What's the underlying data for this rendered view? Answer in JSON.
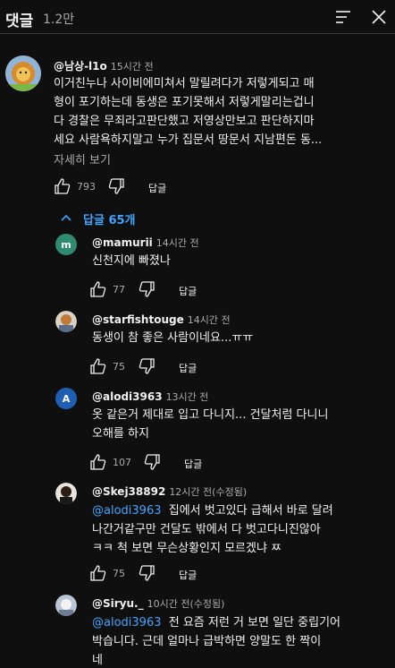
{
  "header": {
    "title": "댓글",
    "count": "1.2만",
    "sort_icon": "sort-icon",
    "close_icon": "close-icon"
  },
  "comment": {
    "author": "@남상-l1o",
    "time": "15시간 전",
    "lines": [
      "이거친누나 사이비에미쳐서 말릴려다가 저렇게되고 매",
      "형이 포기하는데 동생은 포기못해서 저렇게말리는겁니",
      "다 경찰은 무죄라고판단했고 저영상만보고 판단하지마",
      "세요 사람욕하지말고 누가 집문서 땅문서 지남편돈 동..."
    ],
    "read_more": "자세히 보기",
    "likes": "793",
    "reply_label": "답글",
    "replies_toggle": "답글 65개"
  },
  "replies": [
    {
      "author": "@mamurii",
      "time": "14시간 전",
      "avatar_letter": "m",
      "avatar_color": "#2e8b6f",
      "lines": [
        "신천지에 빠졌나"
      ],
      "likes": "77",
      "reply_label": "답글"
    },
    {
      "author": "@starfishtouge",
      "time": "14시간 전",
      "lines": [
        "동생이 참 좋은 사람이네요...ㅠㅠ"
      ],
      "likes": "75",
      "reply_label": "답글"
    },
    {
      "author": "@alodi3963",
      "time": "13시간 전",
      "avatar_letter": "A",
      "avatar_color": "#1f5fb3",
      "lines": [
        "옷 같은거 제대로 입고 다니지...  건달처럼 다니니",
        "오해를 하지"
      ],
      "likes": "107",
      "reply_label": "답글"
    },
    {
      "author": "@Skej38892",
      "time": "12시간 전(수정됨)",
      "mention": "@alodi3963",
      "lines": [
        "집에서 벗고있다 급해서 바로 달려",
        "나간거같구만 건달도 밖에서 다 벗고다니진않아",
        "ㅋㅋ 척 보면 무슨상황인지 모르겠냐 ㅉ"
      ],
      "likes": "75",
      "reply_label": "답글"
    },
    {
      "author": "@Siryu._",
      "time": "10시간 전(수정됨)",
      "mention": "@alodi3963",
      "lines": [
        "전 요즘 저런 거 보면 일단 중립기어",
        "박습니다. 근데 얼마나 급박하면 양말도 한 짝이",
        "네"
      ]
    }
  ]
}
